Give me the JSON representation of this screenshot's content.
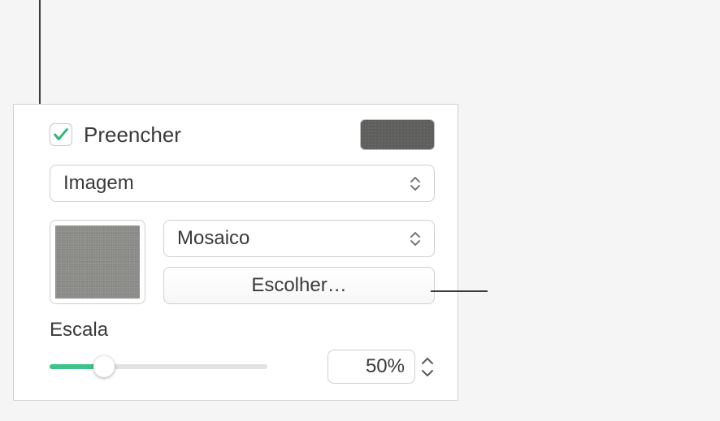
{
  "fill": {
    "checkbox_checked": true,
    "label": "Preencher",
    "swatch_color": "#5e5e5c"
  },
  "fill_type": {
    "selected": "Imagem"
  },
  "image_mode": {
    "selected": "Mosaico"
  },
  "choose_button": {
    "label": "Escolher…"
  },
  "scale": {
    "label": "Escala",
    "value_text": "50%",
    "percent": 25
  }
}
